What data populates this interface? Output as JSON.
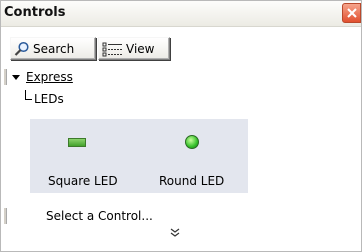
{
  "window": {
    "title": "Controls"
  },
  "toolbar": {
    "search_label": "Search",
    "view_label": "View"
  },
  "tree": {
    "category_label": "Express",
    "subcategory_label": "LEDs"
  },
  "controls": [
    {
      "label": "Square LED",
      "icon": "square-led-icon",
      "color": "#5cbc3c"
    },
    {
      "label": "Round LED",
      "icon": "round-led-icon",
      "color": "#35c02a"
    }
  ],
  "footer": {
    "hint": "Select a Control..."
  },
  "colors": {
    "close_button": "#e1502f",
    "controls_area_background": "#e3e6ee"
  }
}
